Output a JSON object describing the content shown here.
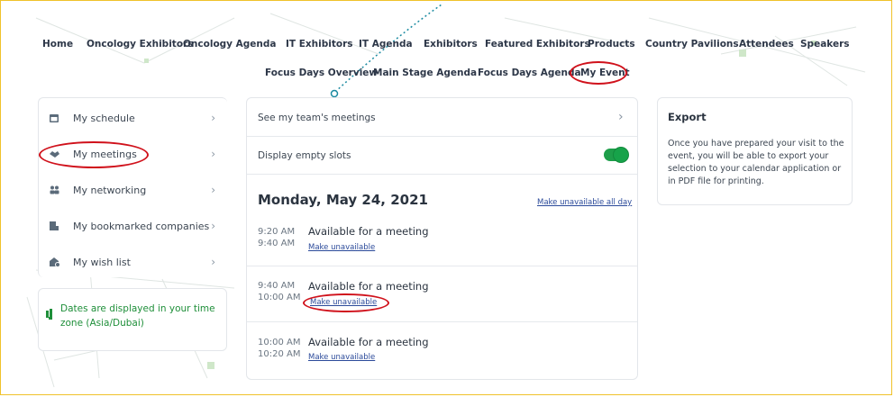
{
  "nav": {
    "row1": [
      "Home",
      "Oncology Exhibitors",
      "Oncology Agenda",
      "IT Exhibitors",
      "IT Agenda",
      "Exhibitors",
      "Featured Exhibitors",
      "Products",
      "Country Pavilions",
      "Attendees",
      "Speakers"
    ],
    "row2": [
      "Focus Days Overview",
      "Main Stage Agenda",
      "Focus Days Agenda",
      "My Event"
    ]
  },
  "sidebar": {
    "items": [
      {
        "label": "My schedule",
        "icon": "calendar-icon"
      },
      {
        "label": "My meetings",
        "icon": "handshake-icon"
      },
      {
        "label": "My networking",
        "icon": "people-icon"
      },
      {
        "label": "My bookmarked companies",
        "icon": "bookmark-building-icon"
      },
      {
        "label": "My wish list",
        "icon": "wishlist-icon"
      }
    ],
    "timezone_note": "Dates are displayed in your time zone (Asia/Dubai)"
  },
  "main": {
    "team_meetings_label": "See my team's meetings",
    "empty_slots_label": "Display empty slots",
    "empty_slots_enabled": true,
    "date_title": "Monday, May 24, 2021",
    "unavailable_all_day_label": "Make unavailable all day",
    "slots": [
      {
        "start": "9:20 AM",
        "end": "9:40 AM",
        "title": "Available for a meeting",
        "action": "Make unavailable"
      },
      {
        "start": "9:40 AM",
        "end": "10:00 AM",
        "title": "Available for a meeting",
        "action": "Make unavailable"
      },
      {
        "start": "10:00 AM",
        "end": "10:20 AM",
        "title": "Available for a meeting",
        "action": "Make unavailable"
      }
    ]
  },
  "export": {
    "title": "Export",
    "text": "Once you have prepared your visit to the event, you will be able to export your selection to your calendar application or in PDF file for printing."
  },
  "colors": {
    "annotation_red": "#d0111b",
    "toggle_green": "#17a34a",
    "timezone_green": "#1f8f3a",
    "frame_yellow": "#f0c22a"
  }
}
